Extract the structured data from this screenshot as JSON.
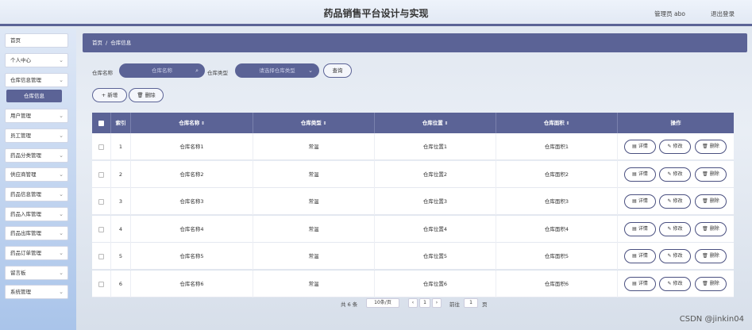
{
  "header": {
    "title": "药品销售平台设计与实现",
    "user": "管理员 abo",
    "logout": "退出登录"
  },
  "sidebar": {
    "items": [
      {
        "label": "首页",
        "chevron": ""
      },
      {
        "label": "个人中心",
        "chevron": "⌄"
      },
      {
        "label": "仓库信息管理",
        "chevron": "⌄"
      },
      {
        "label": "用户管理",
        "chevron": "⌄"
      },
      {
        "label": "员工管理",
        "chevron": "⌄"
      },
      {
        "label": "药品分类管理",
        "chevron": "⌄"
      },
      {
        "label": "供应商管理",
        "chevron": "⌄"
      },
      {
        "label": "药品信息管理",
        "chevron": "⌄"
      },
      {
        "label": "药品入库管理",
        "chevron": "⌄"
      },
      {
        "label": "药品出库管理",
        "chevron": "⌄"
      },
      {
        "label": "药品订单管理",
        "chevron": "⌄"
      },
      {
        "label": "留言板",
        "chevron": "⌄"
      },
      {
        "label": "系统管理",
        "chevron": "⌄"
      }
    ],
    "active_sub": "仓库信息"
  },
  "breadcrumb": {
    "home": "首页",
    "sep": "/",
    "current": "仓库信息"
  },
  "search": {
    "name_label": "仓库名称",
    "name_placeholder": "仓库名称",
    "type_label": "仓库类型",
    "type_placeholder": "请选择仓库类型",
    "query_button": "查询",
    "add_button": "+ 新增",
    "delete_button": "删除"
  },
  "table": {
    "headers": {
      "index": "索引",
      "name": "仓库名称",
      "type": "仓库类型",
      "location": "仓库位置",
      "area": "仓库面积",
      "ops": "操作",
      "sort_glyph": "⇕"
    },
    "rows": [
      {
        "index": "1",
        "name": "仓库名称1",
        "type": "常温",
        "location": "仓库位置1",
        "area": "仓库面积1"
      },
      {
        "index": "2",
        "name": "仓库名称2",
        "type": "常温",
        "location": "仓库位置2",
        "area": "仓库面积2"
      },
      {
        "index": "3",
        "name": "仓库名称3",
        "type": "常温",
        "location": "仓库位置3",
        "area": "仓库面积3"
      },
      {
        "index": "4",
        "name": "仓库名称4",
        "type": "常温",
        "location": "仓库位置4",
        "area": "仓库面积4"
      },
      {
        "index": "5",
        "name": "仓库名称5",
        "type": "常温",
        "location": "仓库位置5",
        "area": "仓库面积5"
      },
      {
        "index": "6",
        "name": "仓库名称6",
        "type": "常温",
        "location": "仓库位置6",
        "area": "仓库面积6"
      }
    ],
    "ops": {
      "detail": "详情",
      "edit": "修改",
      "delete": "删除"
    }
  },
  "pager": {
    "total": "共 6 条",
    "page_size": "10条/页",
    "prev": "‹",
    "current": "1",
    "next": "›",
    "goto_label": "前往",
    "goto_value": "1",
    "page_unit": "页"
  },
  "watermark": "CSDN @jinkin04",
  "colors": {
    "accent": "#5b6396",
    "sidebar_top": "#dfe8f6",
    "sidebar_bottom": "#a9c4ea"
  },
  "icons": {
    "search": "search-icon",
    "chevron": "chevron-down-icon",
    "trash": "trash-icon",
    "detail": "document-icon",
    "edit": "pencil-icon"
  }
}
